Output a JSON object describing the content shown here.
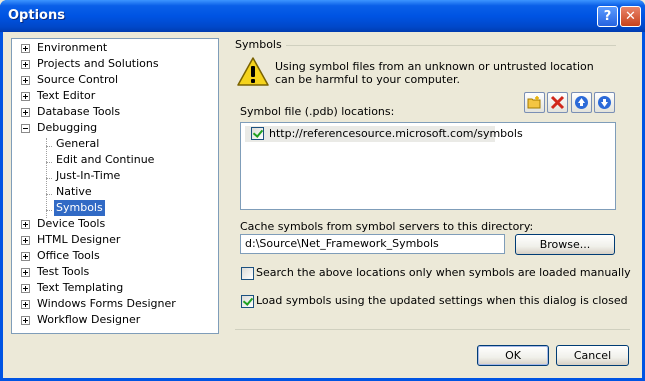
{
  "window": {
    "title": "Options",
    "help_glyph": "?",
    "close_glyph": "✕"
  },
  "tree": {
    "items": [
      {
        "label": "Environment",
        "expander": "plus"
      },
      {
        "label": "Projects and Solutions",
        "expander": "plus"
      },
      {
        "label": "Source Control",
        "expander": "plus"
      },
      {
        "label": "Text Editor",
        "expander": "plus"
      },
      {
        "label": "Database Tools",
        "expander": "plus"
      },
      {
        "label": "Debugging",
        "expander": "minus"
      },
      {
        "label": "General",
        "child": true
      },
      {
        "label": "Edit and Continue",
        "child": true
      },
      {
        "label": "Just-In-Time",
        "child": true
      },
      {
        "label": "Native",
        "child": true
      },
      {
        "label": "Symbols",
        "child": true,
        "selected": true
      },
      {
        "label": "Device Tools",
        "expander": "plus"
      },
      {
        "label": "HTML Designer",
        "expander": "plus"
      },
      {
        "label": "Office Tools",
        "expander": "plus"
      },
      {
        "label": "Test Tools",
        "expander": "plus"
      },
      {
        "label": "Text Templating",
        "expander": "plus"
      },
      {
        "label": "Windows Forms Designer",
        "expander": "plus"
      },
      {
        "label": "Workflow Designer",
        "expander": "plus"
      }
    ]
  },
  "panel": {
    "group_title": "Symbols",
    "warning_icon": "warning-icon",
    "warning_text": "Using symbol files from an unknown or untrusted location can be harmful to your computer.",
    "locations_label": "Symbol file (.pdb) locations:",
    "toolbar": [
      "new-folder-icon",
      "delete-icon",
      "move-up-icon",
      "move-down-icon"
    ],
    "locations": [
      {
        "url": "http://referencesource.microsoft.com/symbols",
        "checked": true
      }
    ],
    "cache_label": "Cache symbols from symbol servers to this directory:",
    "cache_value": "d:\\Source\\Net_Framework_Symbols",
    "browse_label": "Browse...",
    "search_manual_label": "Search the above locations only when symbols are loaded manually",
    "search_manual_checked": false,
    "load_updated_label": "Load symbols using the updated settings when this dialog is closed",
    "load_updated_checked": true
  },
  "footer": {
    "ok_label": "OK",
    "cancel_label": "Cancel"
  },
  "colors": {
    "title_bar": "#0054E3",
    "selection": "#316AC5",
    "face": "#ECE9D8",
    "warning": "#F5D31C"
  }
}
